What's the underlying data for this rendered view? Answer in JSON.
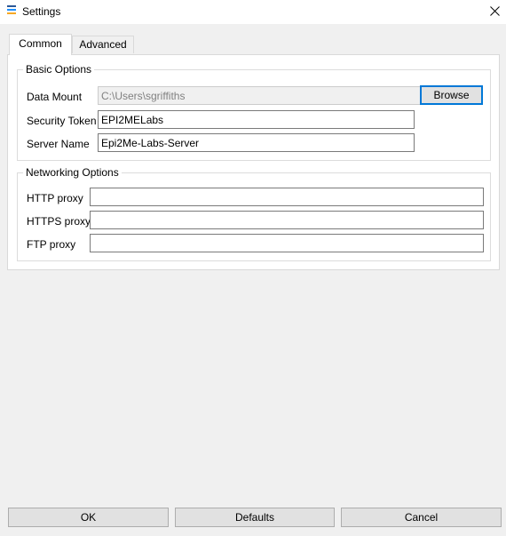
{
  "window": {
    "title": "Settings"
  },
  "colors": {
    "icon_top": "#2b5797",
    "icon_mid": "#1e90ff",
    "icon_bottom": "#f7a823",
    "focus_border": "#0078d7"
  },
  "tabs": [
    {
      "label": "Common",
      "selected": true
    },
    {
      "label": "Advanced",
      "selected": false
    }
  ],
  "basic_options": {
    "title": "Basic Options",
    "data_mount_label": "Data Mount",
    "data_mount_value": "C:\\Users\\sgriffiths",
    "browse_label": "Browse",
    "security_token_label": "Security Token",
    "security_token_value": "EPI2MELabs",
    "server_name_label": "Server Name",
    "server_name_value": "Epi2Me-Labs-Server"
  },
  "networking_options": {
    "title": "Networking Options",
    "http_label": "HTTP proxy",
    "http_value": "",
    "https_label": "HTTPS proxy",
    "https_value": "",
    "ftp_label": "FTP proxy",
    "ftp_value": ""
  },
  "footer": {
    "ok_label": "OK",
    "defaults_label": "Defaults",
    "cancel_label": "Cancel"
  }
}
